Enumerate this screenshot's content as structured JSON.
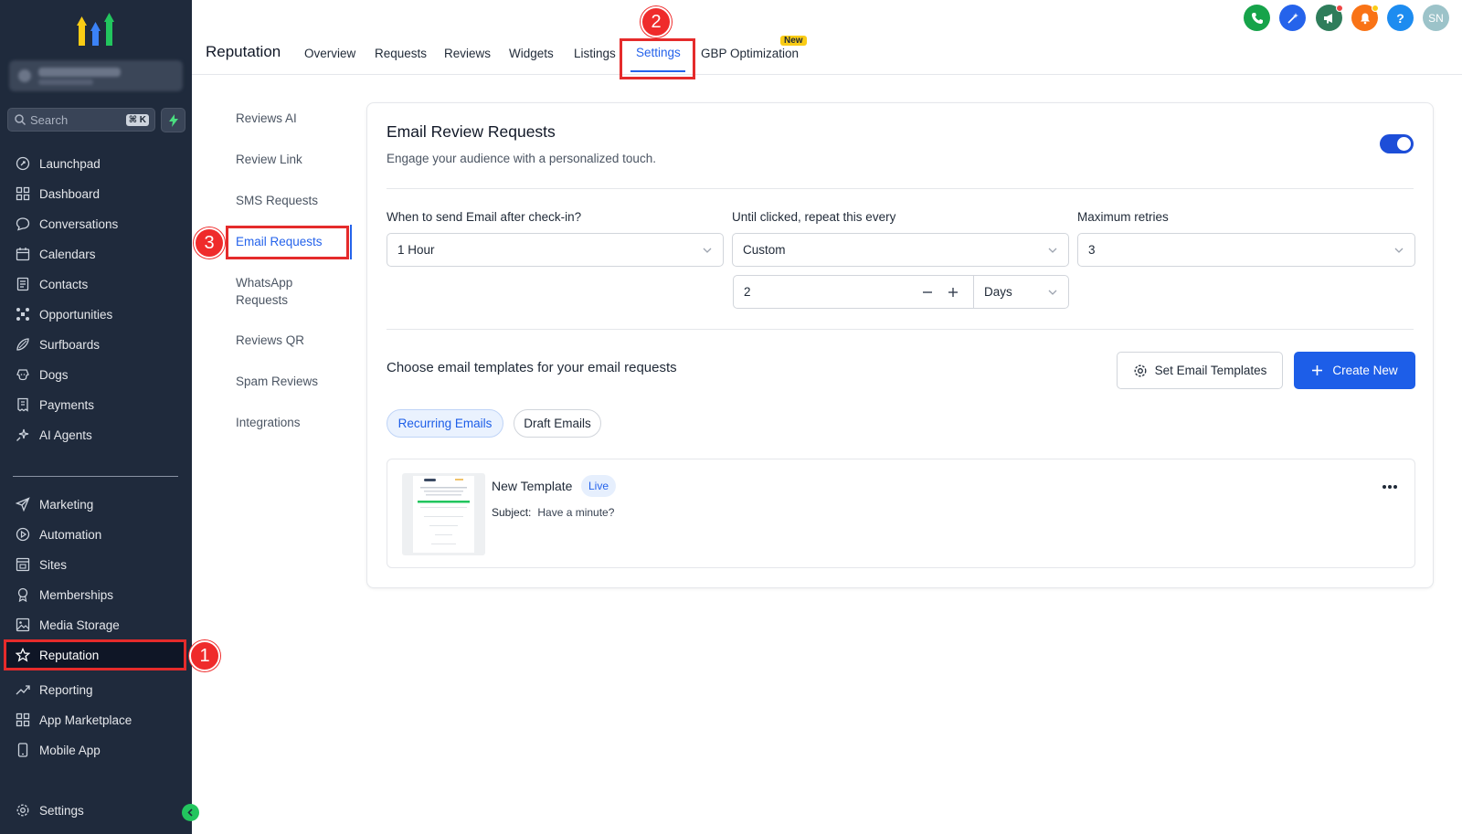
{
  "sidebar": {
    "search_placeholder": "Search",
    "search_shortcut": "⌘ K",
    "items_top": [
      {
        "label": "Launchpad",
        "icon": "rocket-icon"
      },
      {
        "label": "Dashboard",
        "icon": "grid-icon"
      },
      {
        "label": "Conversations",
        "icon": "chat-icon"
      },
      {
        "label": "Calendars",
        "icon": "calendar-icon"
      },
      {
        "label": "Contacts",
        "icon": "contacts-icon"
      },
      {
        "label": "Opportunities",
        "icon": "pipeline-icon"
      },
      {
        "label": "Surfboards",
        "icon": "surfboard-icon"
      },
      {
        "label": "Dogs",
        "icon": "dog-icon"
      },
      {
        "label": "Payments",
        "icon": "receipt-icon"
      },
      {
        "label": "AI Agents",
        "icon": "sparkle-icon"
      }
    ],
    "items_bottom": [
      {
        "label": "Marketing",
        "icon": "send-icon"
      },
      {
        "label": "Automation",
        "icon": "automation-icon"
      },
      {
        "label": "Sites",
        "icon": "sites-icon"
      },
      {
        "label": "Memberships",
        "icon": "award-icon"
      },
      {
        "label": "Media Storage",
        "icon": "image-icon"
      },
      {
        "label": "Reputation",
        "icon": "star-icon"
      },
      {
        "label": "Reporting",
        "icon": "trend-icon"
      },
      {
        "label": "App Marketplace",
        "icon": "apps-icon"
      },
      {
        "label": "Mobile App",
        "icon": "phone-icon"
      }
    ],
    "settings_label": "Settings"
  },
  "annotations": {
    "one": "1",
    "two": "2",
    "three": "3"
  },
  "header": {
    "title": "Reputation",
    "tabs": [
      {
        "label": "Overview"
      },
      {
        "label": "Requests"
      },
      {
        "label": "Reviews"
      },
      {
        "label": "Widgets"
      },
      {
        "label": "Listings"
      },
      {
        "label": "Settings"
      },
      {
        "label": "GBP Optimization"
      }
    ],
    "new_badge": "New",
    "avatar_initials": "SN",
    "help_glyph": "?"
  },
  "subnav": [
    {
      "label": "Reviews AI"
    },
    {
      "label": "Review Link"
    },
    {
      "label": "SMS Requests"
    },
    {
      "label": "Email Requests"
    },
    {
      "label": "WhatsApp Requests"
    },
    {
      "label": "Reviews QR"
    },
    {
      "label": "Spam Reviews"
    },
    {
      "label": "Integrations"
    }
  ],
  "email_requests": {
    "title": "Email Review Requests",
    "subtitle": "Engage your audience with a personalized touch.",
    "enabled": true,
    "send_after_label": "When to send Email after check-in?",
    "send_after_value": "1 Hour",
    "repeat_label": "Until clicked, repeat this every",
    "repeat_value": "Custom",
    "repeat_count": "2",
    "repeat_unit": "Days",
    "max_retries_label": "Maximum retries",
    "max_retries_value": "3",
    "templates_title": "Choose email templates for your email requests",
    "set_templates_label": "Set Email Templates",
    "create_new_label": "Create New",
    "pill_recurring": "Recurring Emails",
    "pill_draft": "Draft Emails",
    "template": {
      "name": "New Template",
      "status": "Live",
      "subject_label": "Subject:",
      "subject_value": "Have a minute?"
    }
  },
  "colors": {
    "sidebar_bg": "#1f2a3c",
    "accent": "#1d5ee8",
    "annotation_red": "#e52b2b"
  }
}
